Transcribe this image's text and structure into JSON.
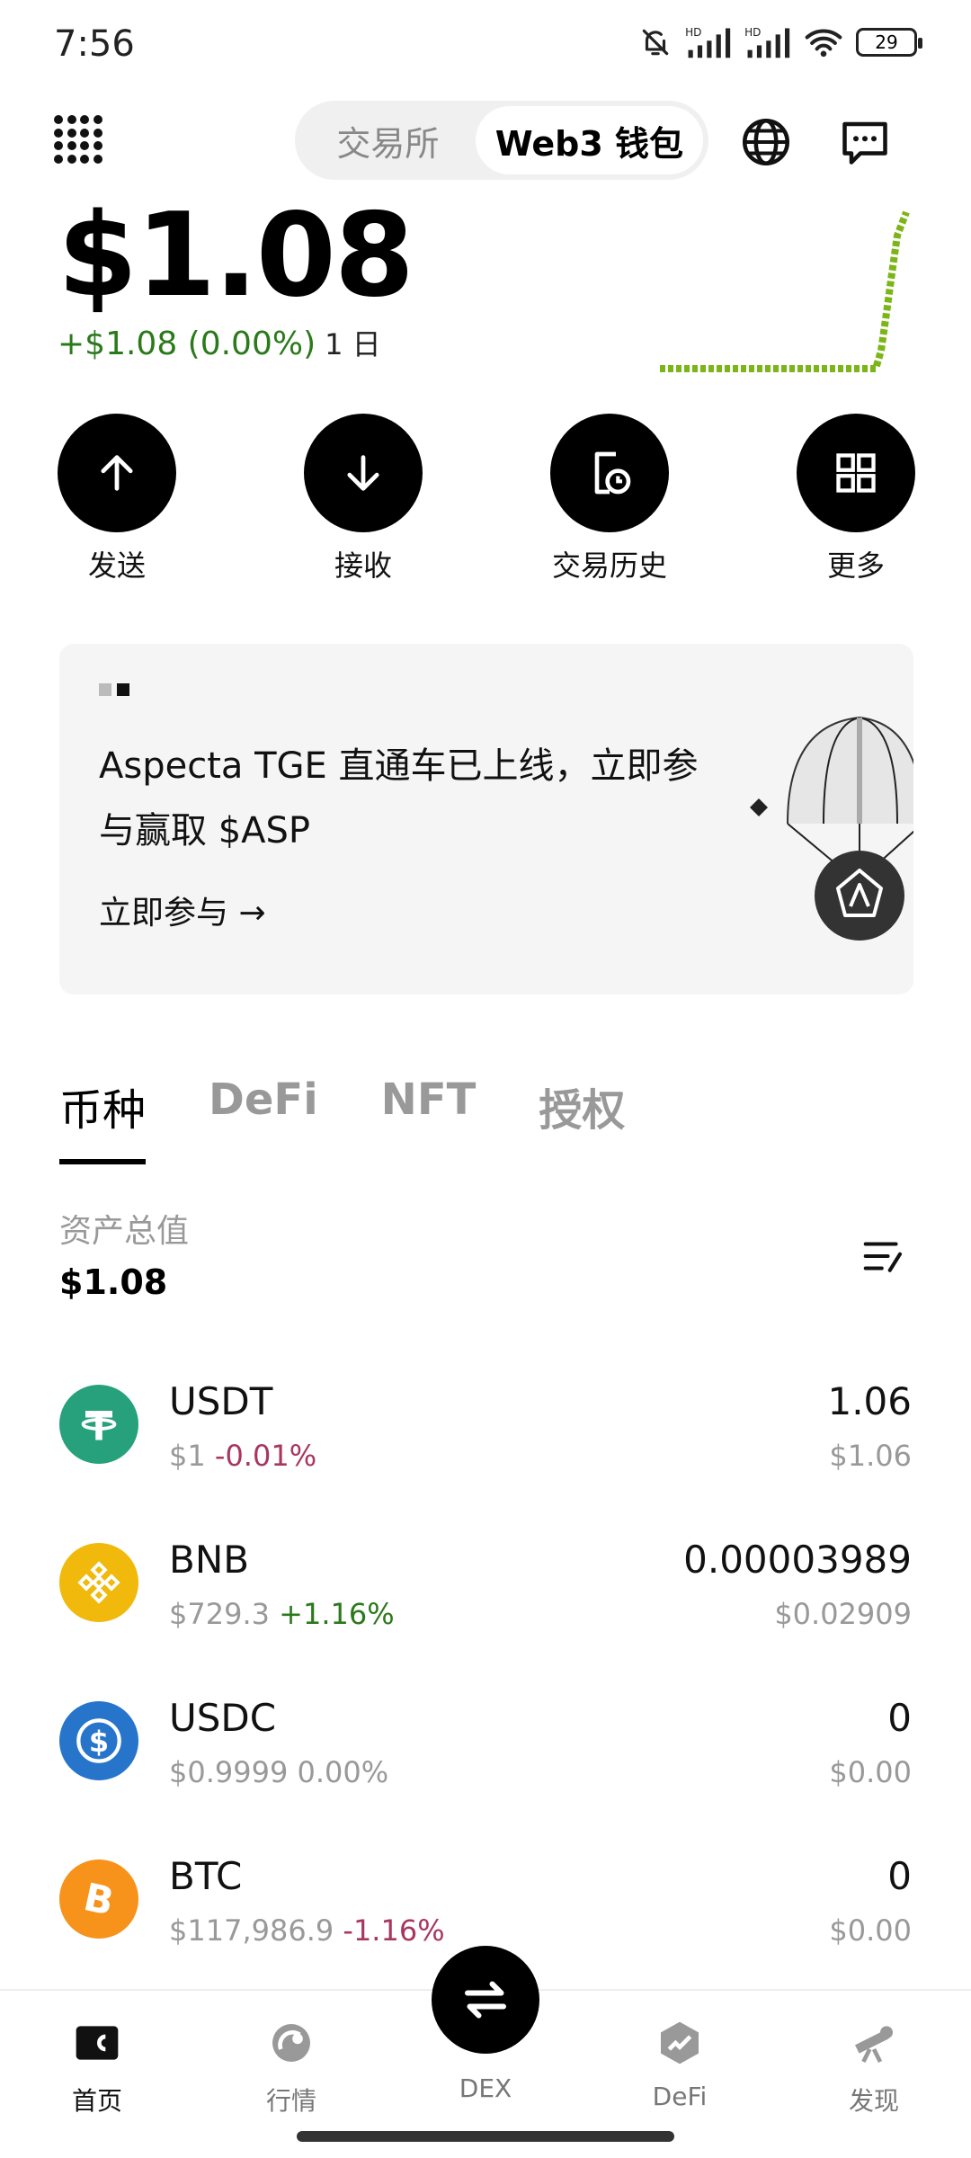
{
  "status": {
    "time": "7:56",
    "battery": "29"
  },
  "header": {
    "tabs": [
      {
        "label": "交易所"
      },
      {
        "label": "Web3 钱包"
      }
    ]
  },
  "wallet": {
    "balance": "$1.08",
    "pnl": "+$1.08 (0.00%)",
    "period": "1 日"
  },
  "actions": [
    {
      "label": "发送"
    },
    {
      "label": "接收"
    },
    {
      "label": "交易历史"
    },
    {
      "label": "更多"
    }
  ],
  "banner": {
    "text": "Aspecta TGE 直通车已上线，立即参与赢取 $ASP",
    "cta": "立即参与 →"
  },
  "tabs": [
    {
      "label": "币种"
    },
    {
      "label": "DeFi"
    },
    {
      "label": "NFT"
    },
    {
      "label": "授权"
    }
  ],
  "total": {
    "label": "资产总值",
    "value": "$1.08"
  },
  "assets": [
    {
      "symbol": "USDT",
      "price": "$1",
      "change": "-0.01%",
      "amount": "1.06",
      "value": "$1.06",
      "color": "#26a17b"
    },
    {
      "symbol": "BNB",
      "price": "$729.3",
      "change": "+1.16%",
      "amount": "0.00003989",
      "value": "$0.02909",
      "color": "#f0b90b"
    },
    {
      "symbol": "USDC",
      "price": "$0.9999",
      "change": "0.00%",
      "amount": "0",
      "value": "$0.00",
      "color": "#2775ca"
    },
    {
      "symbol": "BTC",
      "price": "$117,986.9",
      "change": "-1.16%",
      "amount": "0",
      "value": "$0.00",
      "color": "#f7931a"
    }
  ],
  "nav": [
    {
      "label": "首页"
    },
    {
      "label": "行情"
    },
    {
      "label": "DEX"
    },
    {
      "label": "DeFi"
    },
    {
      "label": "发现"
    }
  ],
  "colors": {
    "positive": "#2a7a1a",
    "negative": "#a83660",
    "sparkline": "#7cb518"
  }
}
